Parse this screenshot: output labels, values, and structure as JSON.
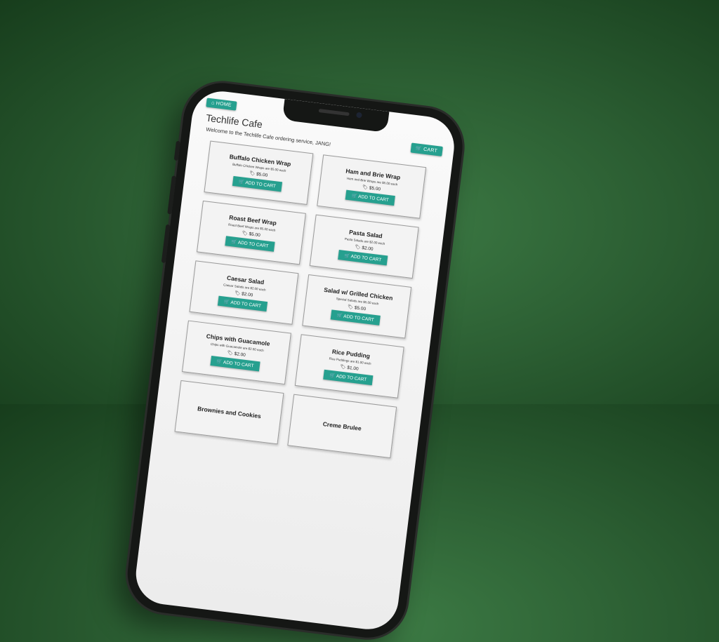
{
  "header": {
    "home_label": "HOME",
    "title": "Techlife Cafe",
    "welcome": "Welcome to the Techlife Cafe ordering service, JANG!",
    "cart_label": "CART"
  },
  "accent": "#26a08f",
  "add_label": "ADD TO CART",
  "items": [
    {
      "name": "Buffalo Chicken Wrap",
      "desc": "Buffalo Chicken Wraps are $5.00 each",
      "price": "$5.00"
    },
    {
      "name": "Ham and Brie Wrap",
      "desc": "Ham and Brie Wraps are $5.00 each",
      "price": "$5.00"
    },
    {
      "name": "Roast Beef Wrap",
      "desc": "Roast Beef Wraps are $5.00 each",
      "price": "$5.00"
    },
    {
      "name": "Pasta Salad",
      "desc": "Pasta Salads are $2.00 each",
      "price": "$2.00"
    },
    {
      "name": "Caesar Salad",
      "desc": "Caesar Salads are $2.00 each",
      "price": "$2.00"
    },
    {
      "name": "Salad w/ Grilled Chicken",
      "desc": "Special Salads are $5.00 each",
      "price": "$5.00"
    },
    {
      "name": "Chips with Guacamole",
      "desc": "Chips with Guacamole are $2.00 each",
      "price": "$2.00"
    },
    {
      "name": "Rice Pudding",
      "desc": "Rice Puddings are $1.00 each",
      "price": "$1.00"
    },
    {
      "name": "Brownies and Cookies"
    },
    {
      "name": "Creme Brulee"
    }
  ]
}
